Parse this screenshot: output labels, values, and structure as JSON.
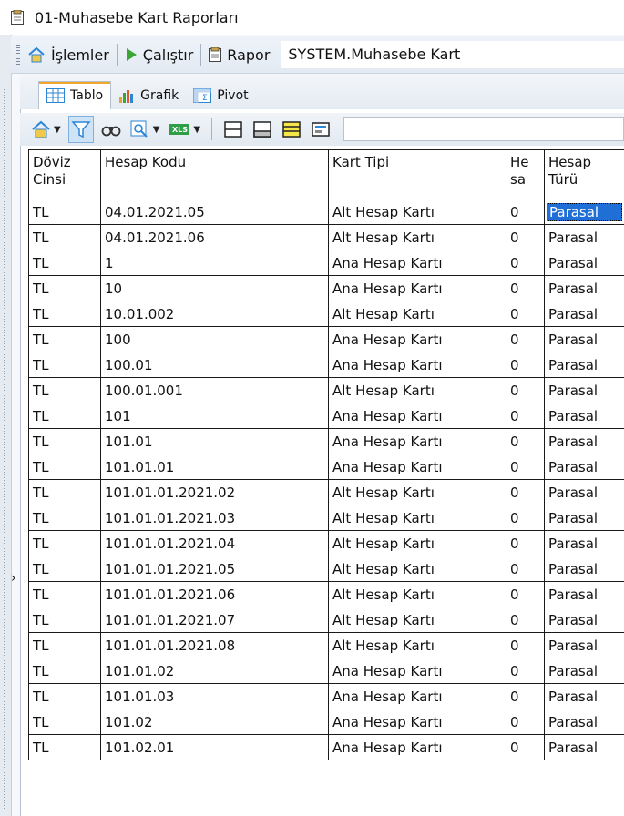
{
  "window": {
    "title": "01-Muhasebe Kart Raporları"
  },
  "menubar": {
    "islemler_label": "İşlemler",
    "calistir_label": "Çalıştır",
    "rapor_label": "Rapor",
    "rapor_value": "SYSTEM.Muhasebe Kart"
  },
  "tabs": [
    {
      "label": "Tablo",
      "active": true
    },
    {
      "label": "Grafik",
      "active": false
    },
    {
      "label": "Pivot",
      "active": false
    }
  ],
  "grid": {
    "columns": [
      "Döviz Cinsi",
      "Hesap Kodu",
      "Kart Tipi",
      "He sa",
      "Hesap Türü"
    ],
    "rows": [
      [
        "TL",
        "04.01.2021.05",
        "Alt Hesap Kartı",
        "0",
        "Parasal"
      ],
      [
        "TL",
        "04.01.2021.06",
        "Alt Hesap Kartı",
        "0",
        "Parasal"
      ],
      [
        "TL",
        "1",
        "Ana Hesap Kartı",
        "0",
        "Parasal"
      ],
      [
        "TL",
        "10",
        "Ana Hesap Kartı",
        "0",
        "Parasal"
      ],
      [
        "TL",
        "10.01.002",
        "Alt Hesap Kartı",
        "0",
        "Parasal"
      ],
      [
        "TL",
        "100",
        "Ana Hesap Kartı",
        "0",
        "Parasal"
      ],
      [
        "TL",
        "100.01",
        "Ana Hesap Kartı",
        "0",
        "Parasal"
      ],
      [
        "TL",
        "100.01.001",
        "Alt Hesap Kartı",
        "0",
        "Parasal"
      ],
      [
        "TL",
        "101",
        "Ana Hesap Kartı",
        "0",
        "Parasal"
      ],
      [
        "TL",
        "101.01",
        "Ana Hesap Kartı",
        "0",
        "Parasal"
      ],
      [
        "TL",
        "101.01.01",
        "Ana Hesap Kartı",
        "0",
        "Parasal"
      ],
      [
        "TL",
        "101.01.01.2021.02",
        "Alt Hesap Kartı",
        "0",
        "Parasal"
      ],
      [
        "TL",
        "101.01.01.2021.03",
        "Alt Hesap Kartı",
        "0",
        "Parasal"
      ],
      [
        "TL",
        "101.01.01.2021.04",
        "Alt Hesap Kartı",
        "0",
        "Parasal"
      ],
      [
        "TL",
        "101.01.01.2021.05",
        "Alt Hesap Kartı",
        "0",
        "Parasal"
      ],
      [
        "TL",
        "101.01.01.2021.06",
        "Alt Hesap Kartı",
        "0",
        "Parasal"
      ],
      [
        "TL",
        "101.01.01.2021.07",
        "Alt Hesap Kartı",
        "0",
        "Parasal"
      ],
      [
        "TL",
        "101.01.01.2021.08",
        "Alt Hesap Kartı",
        "0",
        "Parasal"
      ],
      [
        "TL",
        "101.01.02",
        "Ana Hesap Kartı",
        "0",
        "Parasal"
      ],
      [
        "TL",
        "101.01.03",
        "Ana Hesap Kartı",
        "0",
        "Parasal"
      ],
      [
        "TL",
        "101.02",
        "Ana Hesap Kartı",
        "0",
        "Parasal"
      ],
      [
        "TL",
        "101.02.01",
        "Ana Hesap Kartı",
        "0",
        "Parasal"
      ]
    ],
    "selected_row": 0,
    "selected_col": 4,
    "current_row_indicator": 13
  },
  "colors": {
    "selection": "#1f6fd6",
    "accent": "#f0a72b",
    "run_green": "#3aa635"
  },
  "icons": [
    "document-icon",
    "home-icon",
    "play-icon",
    "report-icon",
    "table-icon",
    "chart-icon",
    "pivot-icon",
    "filter-icon",
    "binoculars-icon",
    "zoom-icon",
    "excel-icon",
    "layout-icon"
  ]
}
